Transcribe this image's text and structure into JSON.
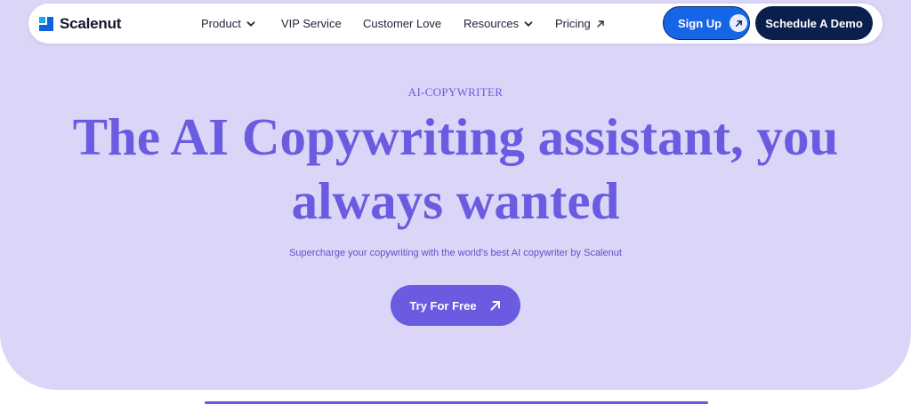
{
  "brand": {
    "name": "Scalenut",
    "logo_icon": "scalenut-logo-icon"
  },
  "nav": {
    "items": [
      {
        "label": "Product",
        "icon": "chevron-down-icon"
      },
      {
        "label": "VIP Service"
      },
      {
        "label": "Customer Love"
      },
      {
        "label": "Resources",
        "icon": "chevron-down-icon"
      },
      {
        "label": "Pricing",
        "icon": "arrow-up-right-icon"
      }
    ],
    "signup_label": "Sign Up",
    "demo_label": "Schedule A Demo"
  },
  "hero": {
    "eyebrow": "AI-COPYWRITER",
    "headline": "The AI Copywriting assistant, you always wanted",
    "subtitle": "Supercharge your copywriting with the world's best AI copywriter by Scalenut",
    "cta_label": "Try For Free"
  },
  "colors": {
    "hero_bg": "#dbd6f7",
    "accent": "#6a5be0",
    "signup_blue": "#1565e6",
    "demo_navy": "#0b1f4d"
  }
}
